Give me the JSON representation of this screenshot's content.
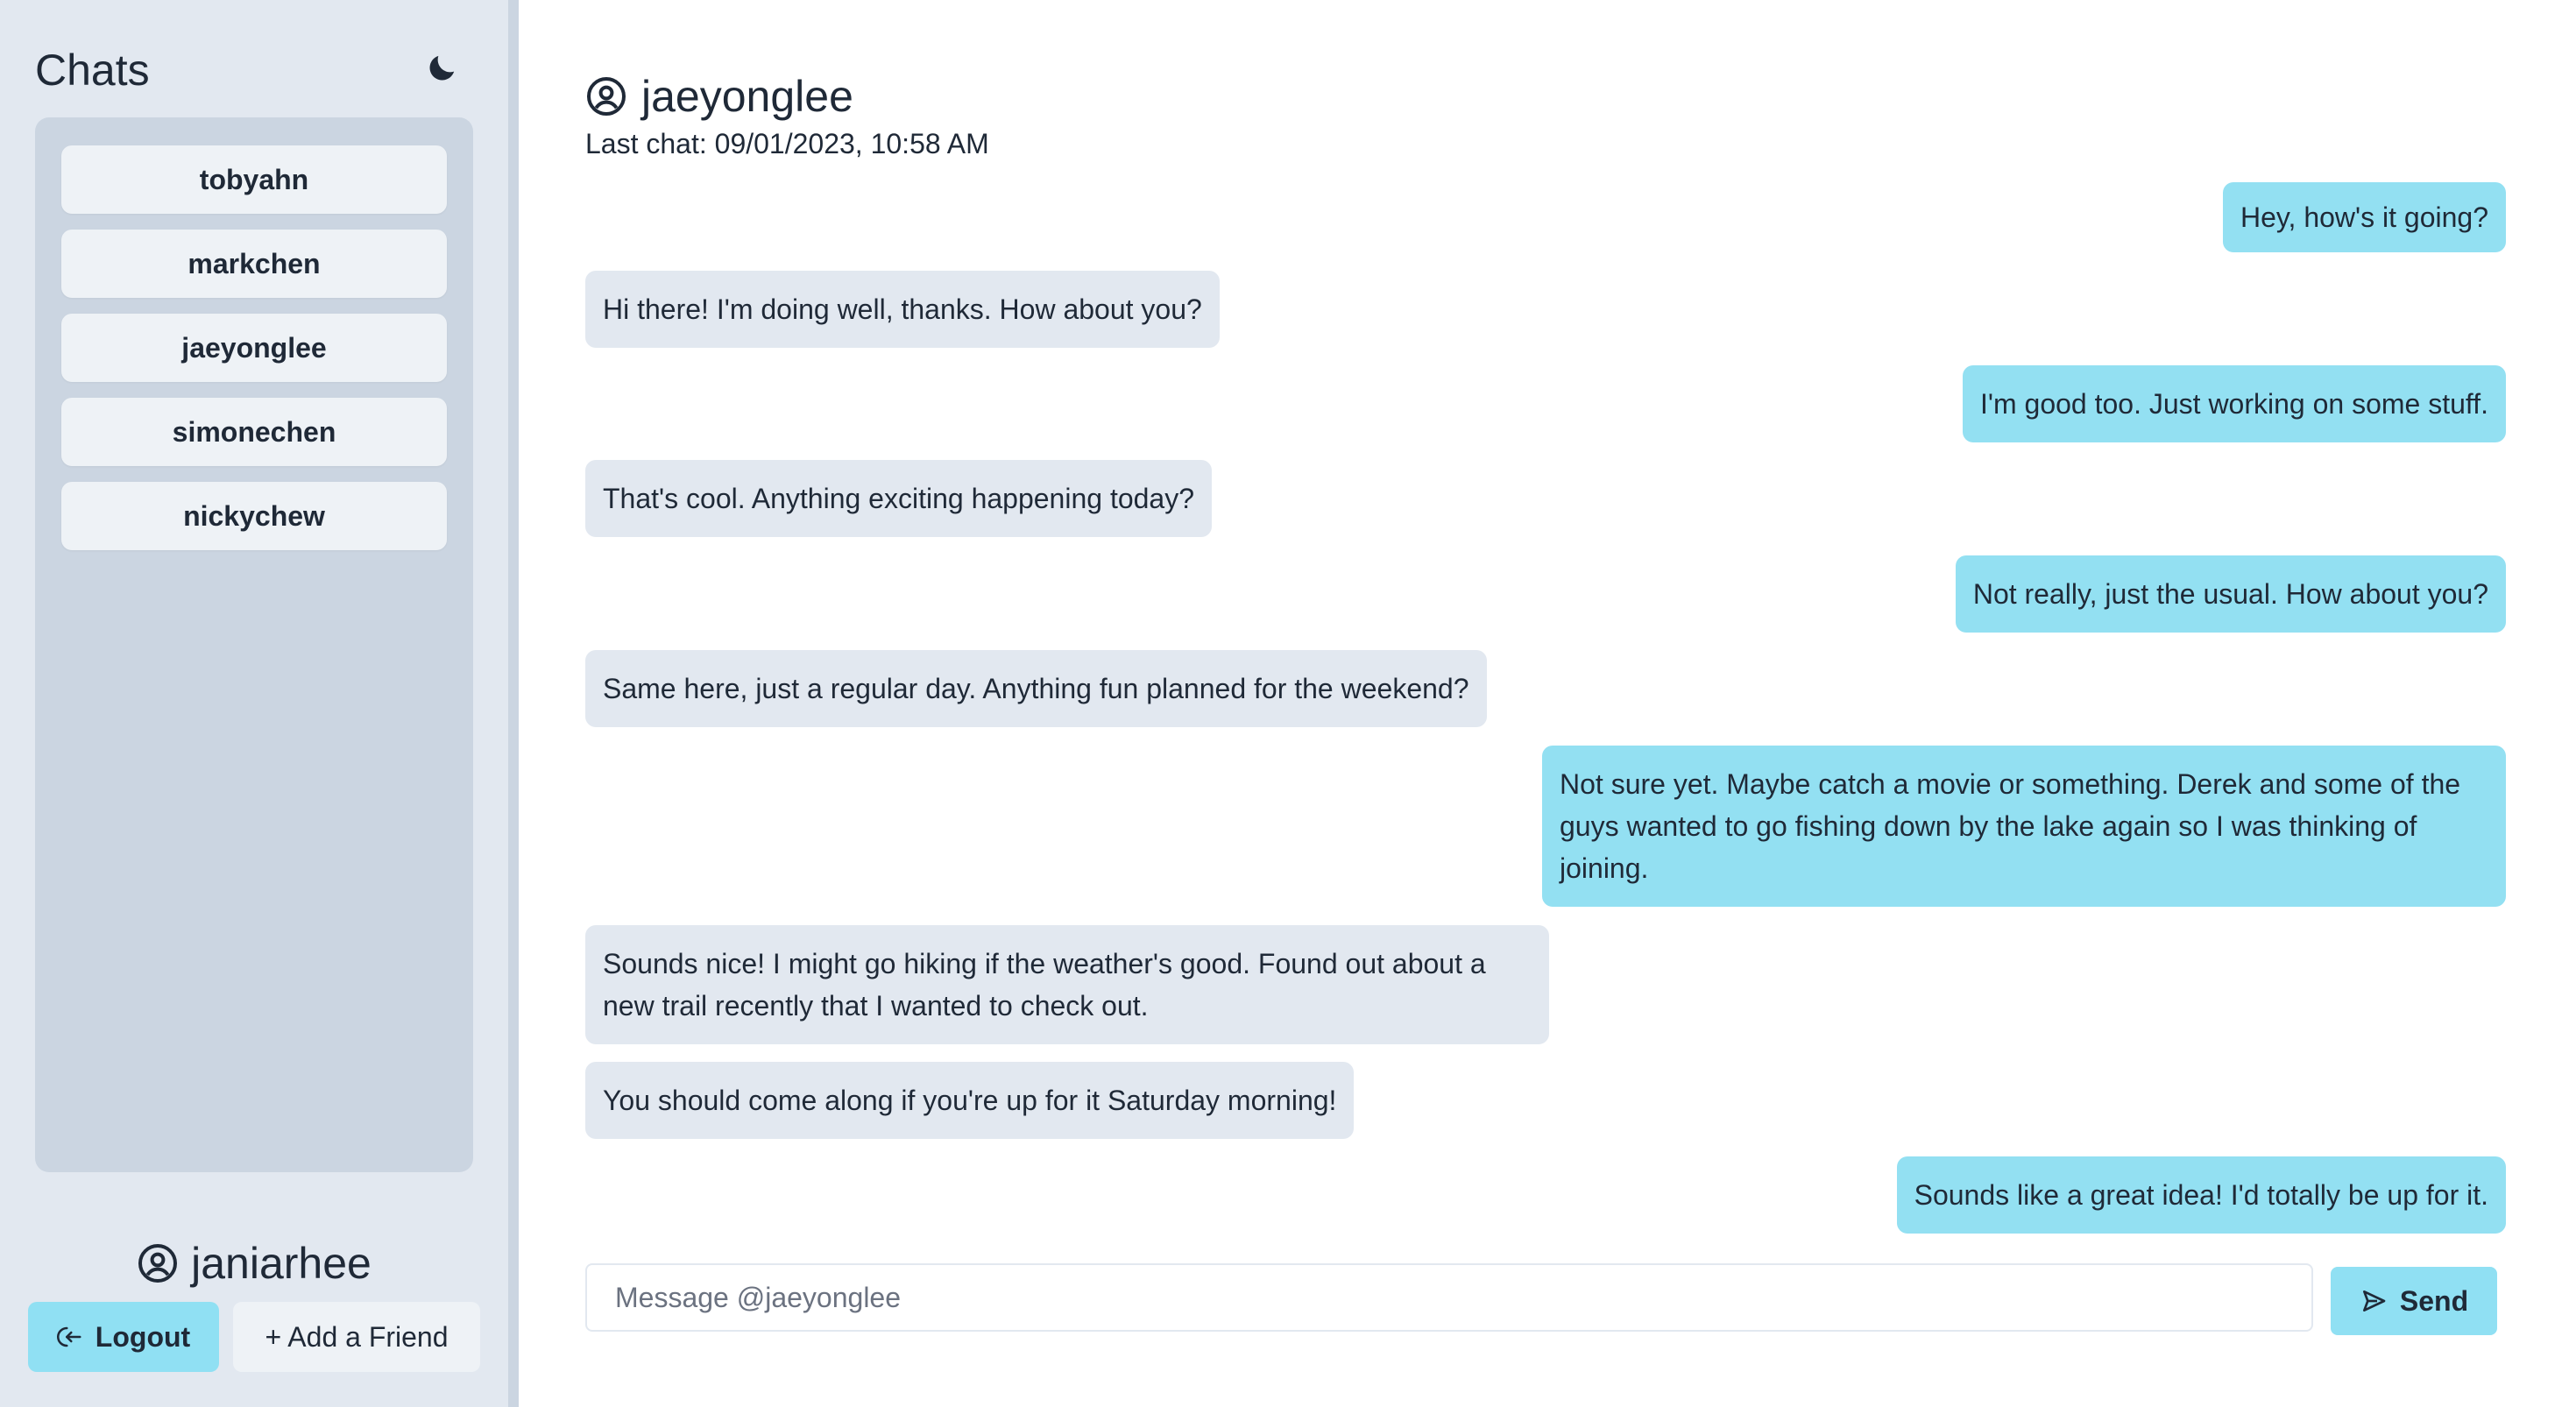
{
  "sidebar": {
    "title": "Chats",
    "theme_icon": "moon-icon",
    "chats": [
      {
        "label": "tobyahn"
      },
      {
        "label": "markchen"
      },
      {
        "label": "jaeyonglee"
      },
      {
        "label": "simonechen"
      },
      {
        "label": "nickychew"
      }
    ],
    "current_user": "janiarhee",
    "user_icon": "user-circle-icon",
    "logout_label": "Logout",
    "logout_icon": "logout-icon",
    "add_friend_label": "+ Add a Friend"
  },
  "chat": {
    "contact_name": "jaeyonglee",
    "contact_icon": "user-circle-icon",
    "last_chat": "Last chat: 09/01/2023, 10:58 AM",
    "messages": [
      {
        "from": "me",
        "text": "Hey, how's it going?"
      },
      {
        "from": "them",
        "text": "Hi there! I'm doing well, thanks. How about you?"
      },
      {
        "from": "me",
        "text": "I'm good too. Just working on some stuff."
      },
      {
        "from": "them",
        "text": "That's cool. Anything exciting happening today?"
      },
      {
        "from": "me",
        "text": "Not really, just the usual. How about you?"
      },
      {
        "from": "them",
        "text": "Same here, just a regular day. Anything fun planned for the weekend?"
      },
      {
        "from": "me",
        "text": "Not sure yet. Maybe catch a movie or something. Derek and some of the guys wanted to go fishing down by the lake again so I was thinking of joining."
      },
      {
        "from": "them",
        "text": "Sounds nice! I might go hiking if the weather's good. Found out about a new trail recently that I wanted to check out."
      },
      {
        "from": "them",
        "text": "You should come along if you're up for it Saturday morning!"
      },
      {
        "from": "me",
        "text": "Sounds like a great idea! I'd totally be up for it."
      }
    ],
    "composer": {
      "placeholder": "Message @jaeyonglee",
      "value": ""
    },
    "send_label": "Send",
    "send_icon": "send-icon"
  },
  "colors": {
    "sent_bubble": "#93e0f2",
    "received_bubble": "#e2e8f0",
    "sidebar_bg": "#e2e8f0",
    "chat_list_bg": "#cbd5e1",
    "accent_button": "#90e0f3"
  }
}
